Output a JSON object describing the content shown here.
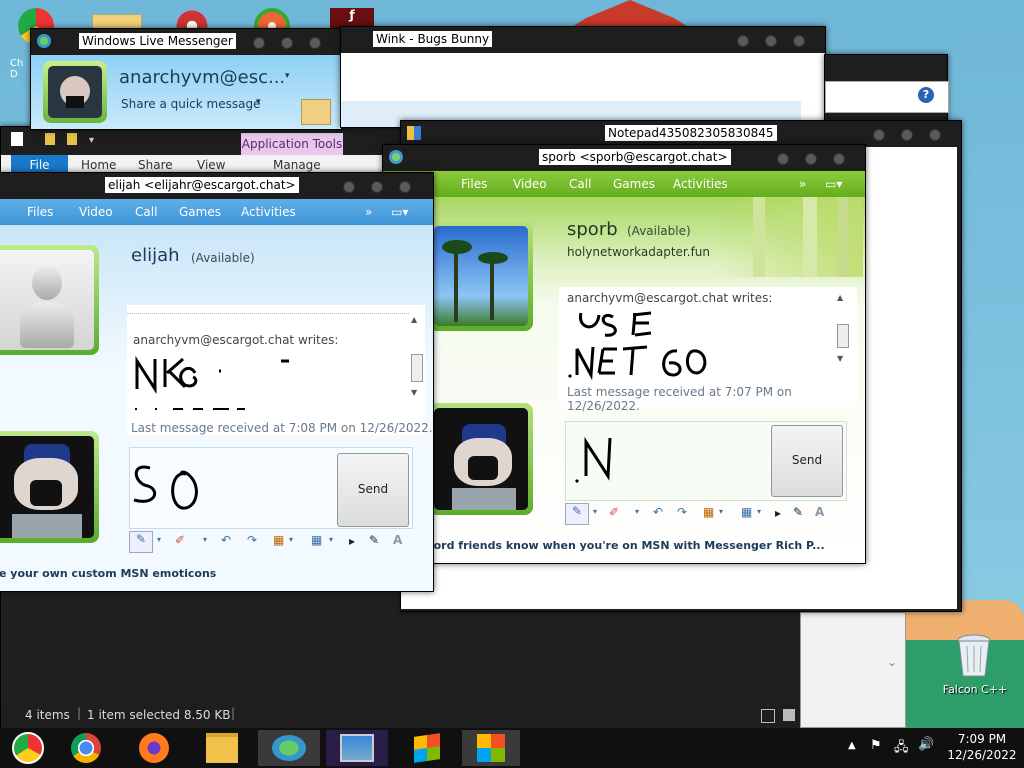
{
  "desktop": {
    "recycle_label": "Falcon C++",
    "partial_icon_label": "Ch\nD"
  },
  "wlm_main": {
    "title": "Windows Live Messenger",
    "user": "anarchyvm@esc...",
    "status_prompt": "Share a quick message"
  },
  "wink_window": {
    "title": "Wink - Bugs Bunny"
  },
  "explorer": {
    "ribbon_context": "Application Tools",
    "tabs": [
      "File",
      "Home",
      "Share",
      "View",
      "Manage"
    ],
    "status_items": "4 items",
    "status_selected": "1 item selected  8.50 KB",
    "help_icon": "?"
  },
  "notepad": {
    "title": "Notepad435082305830845"
  },
  "elijah_chat": {
    "title": "elijah <elijahr@escargot.chat>",
    "menu": [
      "Files",
      "Video",
      "Call",
      "Games",
      "Activities"
    ],
    "contact_name": "elijah",
    "contact_status": "(Available)",
    "writes": "anarchyvm@escargot.chat writes:",
    "last_msg": "Last message received at 7:08 PM on 12/26/2022.",
    "send_label": "Send",
    "footer": "e your own custom MSN emoticons"
  },
  "sporb_chat": {
    "title": "sporb <sporb@escargot.chat>",
    "menu": [
      "Files",
      "Video",
      "Call",
      "Games",
      "Activities"
    ],
    "contact_name": "sporb",
    "contact_status": "(Available)",
    "psm": "holynetworkadapter.fun",
    "writes": "anarchyvm@escargot.chat writes:",
    "last_msg": "Last message received at 7:07 PM on 12/26/2022.",
    "send_label": "Send",
    "footer": "our Discord friends know when you're on MSN with Messenger Rich P..."
  },
  "taskbar": {
    "time": "7:09 PM",
    "date": "12/26/2022"
  },
  "colors": {
    "msn_blue": "#3d93d6",
    "msn_green": "#64ac1f",
    "taskbar": "#101010"
  }
}
